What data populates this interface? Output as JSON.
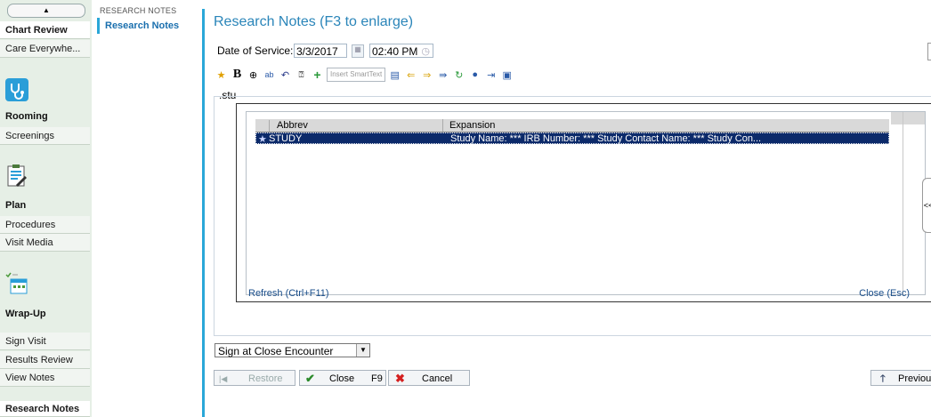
{
  "sidebar": {
    "items": {
      "chart_review": "Chart Review",
      "care_everywhere": "Care Everywhe...",
      "rooming": "Rooming",
      "screenings": "Screenings",
      "plan": "Plan",
      "procedures": "Procedures",
      "visit_media": "Visit Media",
      "wrap_up": "Wrap-Up",
      "sign_visit": "Sign Visit",
      "results_review": "Results Review",
      "view_notes": "View Notes",
      "research_notes": "Research Notes"
    }
  },
  "secnav": {
    "header": "RESEARCH NOTES",
    "selected": "Research Notes"
  },
  "main": {
    "title": "Research Notes (F3 to enlarge)",
    "date_label": "Date of Service:",
    "date_value": "3/3/2017",
    "time_value": "02:40 PM",
    "smarttext_placeholder": "Insert SmartText",
    "editor_text": ".stu"
  },
  "popup": {
    "col_abbrev": "Abbrev",
    "col_expansion": "Expansion",
    "rows": [
      {
        "abbrev": "STUDY",
        "expansion": "Study Name: *** IRB Number: *** Study Contact Name: *** Study Con..."
      }
    ],
    "refresh_link": "Refresh (Ctrl+F11)",
    "close_link": "Close (Esc)",
    "side_tab": "<<"
  },
  "footer": {
    "sign_option": "Sign at Close Encounter",
    "restore": "Restore",
    "close": "Close",
    "close_key": "F9",
    "cancel": "Cancel",
    "previous": "Previous"
  },
  "colors": {
    "accent": "#2aa7d8",
    "title": "#2a85b9",
    "selected_row": "#0c2a6a",
    "sidebar_bg": "#e6efe6"
  }
}
